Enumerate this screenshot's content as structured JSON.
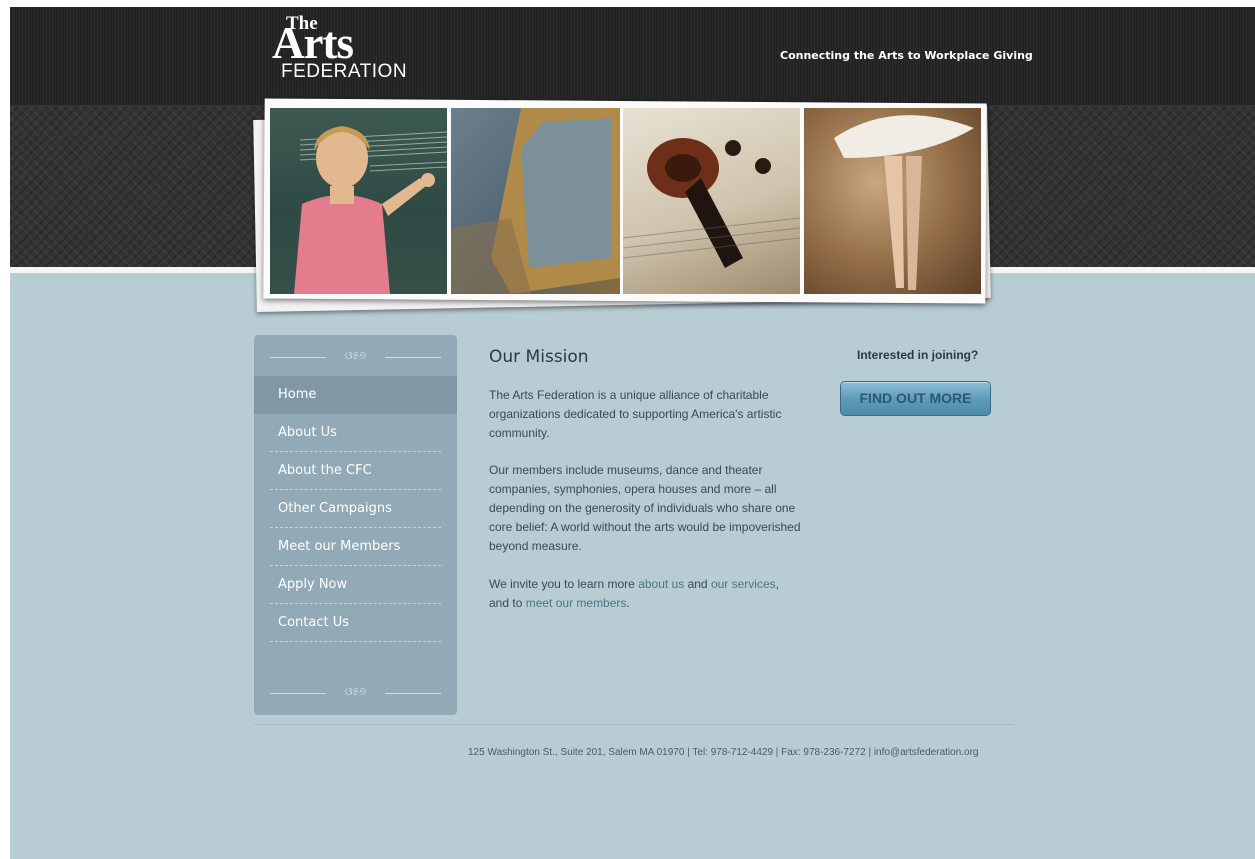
{
  "header": {
    "logo": {
      "the": "The",
      "arts": "Arts",
      "federation": "FEDERATION"
    },
    "tagline": "Connecting the Arts to Workplace Giving"
  },
  "photos": [
    {
      "name": "girl-music-teacher"
    },
    {
      "name": "gilded-picture-frame"
    },
    {
      "name": "violin-scroll"
    },
    {
      "name": "ballerina-en-pointe"
    }
  ],
  "sidebar": {
    "ornament_glyph": "ଓ୫୭",
    "items": [
      {
        "label": "Home",
        "active": true
      },
      {
        "label": "About Us"
      },
      {
        "label": "About the CFC"
      },
      {
        "label": "Other Campaigns"
      },
      {
        "label": "Meet our Members"
      },
      {
        "label": "Apply Now"
      },
      {
        "label": "Contact Us"
      }
    ]
  },
  "main": {
    "title": "Our Mission",
    "p1": "The Arts Federation is a unique alliance of charitable organizations dedicated to supporting America's artistic community.",
    "p2": "Our members include museums, dance and theater companies, symphonies, opera houses and more – all depending on the generosity of individuals who share one core belief: A world without the arts would be impoverished beyond measure.",
    "p3": {
      "intro": "We invite you to learn more ",
      "link_about": "about us",
      "and": " and ",
      "link_services": "our services",
      "comma": ",",
      "and_to": "and to ",
      "link_members": "meet our members",
      "period": "."
    }
  },
  "aside": {
    "join_label": "Interested in joining?",
    "button_label": "FIND OUT MORE"
  },
  "footer": {
    "text": "125 Washington St., Suite 201, Salem MA 01970 | Tel: 978-712-4429 | Fax: 978-236-7272 | info@artsfederation.org"
  },
  "colors": {
    "page_bg": "#b8ccd4",
    "header_dark": "#232323",
    "sidebar": "#91aab5",
    "link": "#4f7482",
    "button": "#5f9bbb"
  }
}
